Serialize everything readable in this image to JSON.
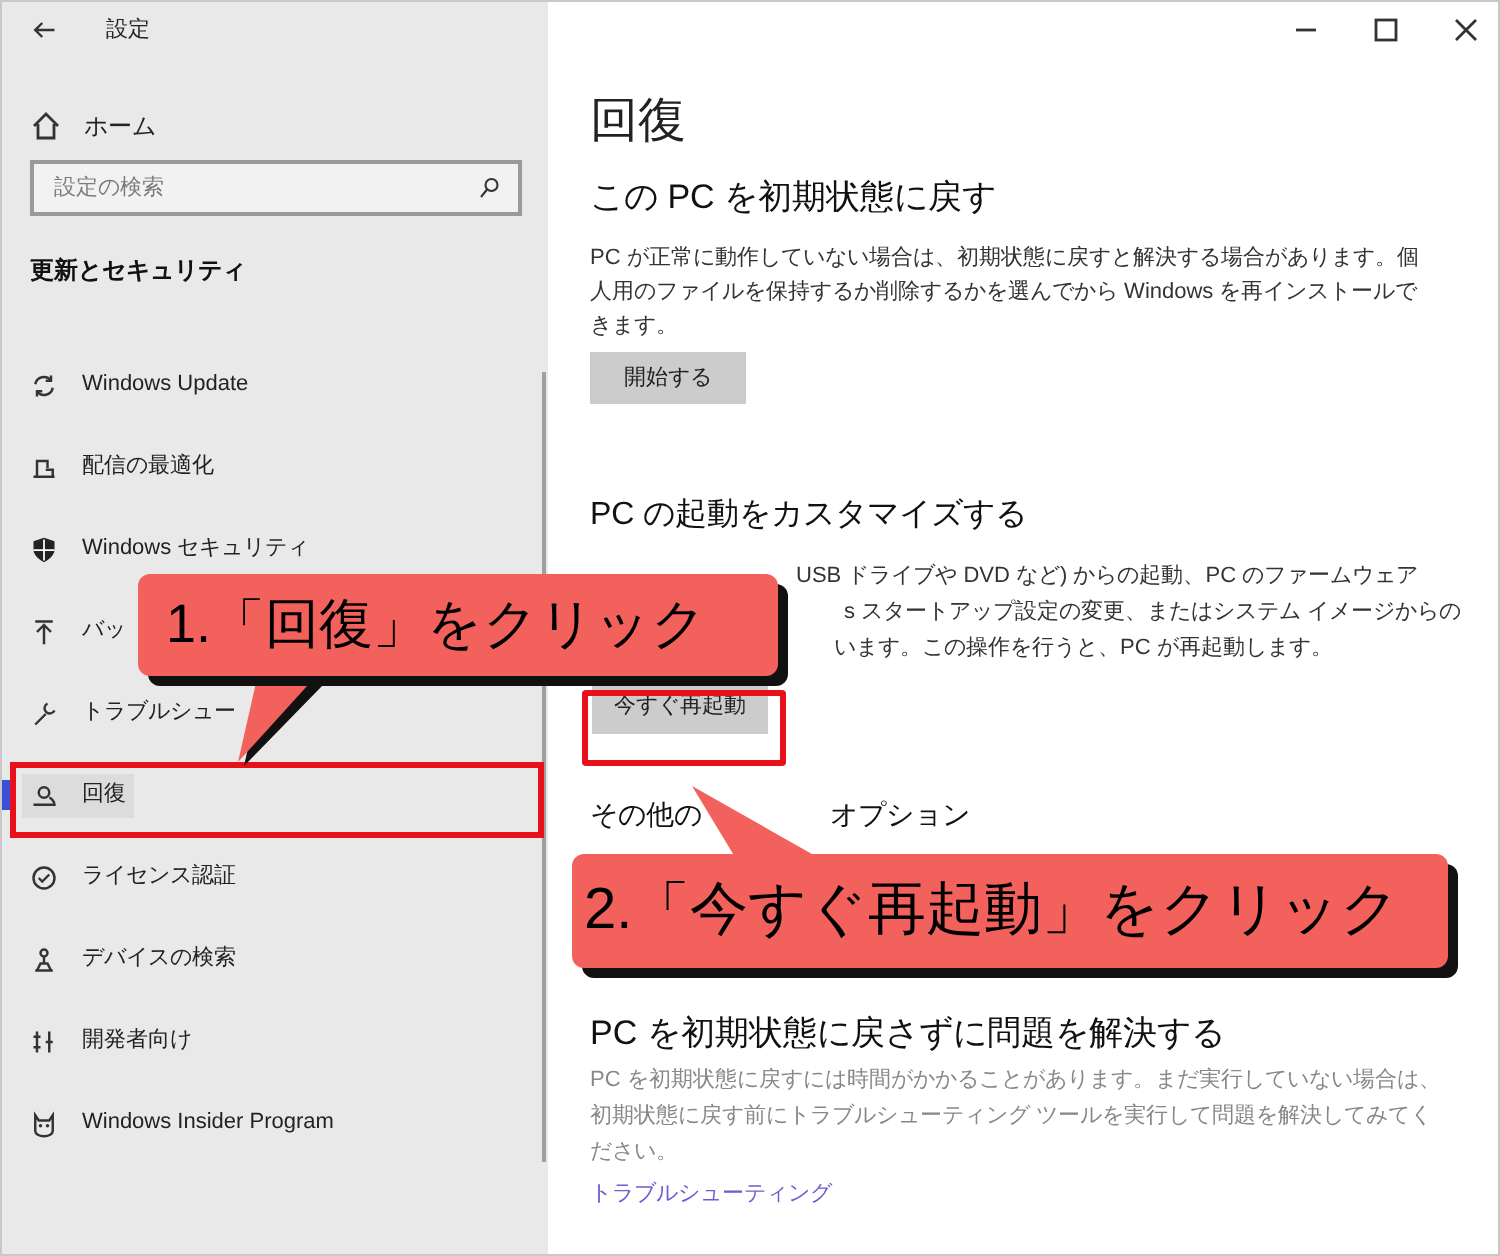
{
  "window": {
    "title": "設定"
  },
  "sidebar": {
    "home": "ホーム",
    "search": {
      "placeholder": "設定の検索"
    },
    "heading": "更新とセキュリティ",
    "items": [
      {
        "label": "Windows Update",
        "selected": false
      },
      {
        "label": "配信の最適化",
        "selected": false
      },
      {
        "label": "Windows セキュリティ",
        "selected": false
      },
      {
        "label": "バッ",
        "selected": false
      },
      {
        "label": "トラブルシュー",
        "selected": false
      },
      {
        "label": "回復",
        "selected": true
      },
      {
        "label": "ライセンス認証",
        "selected": false
      },
      {
        "label": "デバイスの検索",
        "selected": false
      },
      {
        "label": "開発者向け",
        "selected": false
      },
      {
        "label": "Windows Insider Program",
        "selected": false
      }
    ]
  },
  "page": {
    "title": "回復",
    "reset": {
      "heading": "この PC を初期状態に戻す",
      "text": "PC が正常に動作していない場合は、初期状態に戻すと解決する場合があります。個人用のファイルを保持するか削除するかを選んでから Windows を再インストールできます。",
      "button": "開始する"
    },
    "startup": {
      "heading": "PC の起動をカスタマイズする",
      "text_lines": [
        "USB ドライブや DVD など) からの起動、PC のファームウェア",
        "s スタートアップ設定の変更、またはシステム イメージからの",
        "います。この操作を行うと、PC が再起動します。"
      ],
      "button": "今すぐ再起動"
    },
    "more_options": {
      "heading_parts": [
        "その他の",
        "オプション"
      ]
    },
    "troubleshoot": {
      "heading": "PC を初期状態に戻さずに問題を解決する",
      "text": "PC を初期状態に戻すには時間がかかることがあります。まだ実行していない場合は、初期状態に戻す前にトラブルシューティング ツールを実行して問題を解決してみてください。",
      "link": "トラブルシューティング"
    }
  },
  "annotations": [
    {
      "text": "1.「回復」をクリック"
    },
    {
      "text": "2.「今すぐ再起動」をクリック"
    }
  ]
}
